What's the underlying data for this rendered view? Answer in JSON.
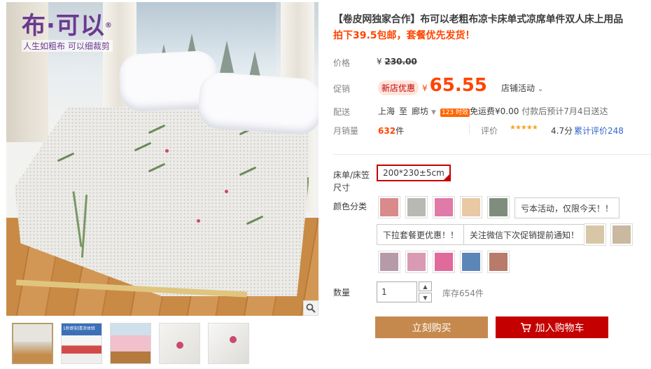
{
  "gallery": {
    "brand_mark": "布·可以",
    "brand_tm": "®",
    "brand_slogan": "人生如粗布  可以细裁剪",
    "thumbnail_badge": "1秒即刻清凉体验"
  },
  "product": {
    "title": "【卷皮网独家合作】布可以老粗布凉卡床单式凉席单件双人床上用品",
    "subtitle": "拍下39.5包邮，套餐优先发货！"
  },
  "price": {
    "label": "价格",
    "currency": "¥",
    "original": "230.00"
  },
  "promo": {
    "label": "促销",
    "tag": "新店优惠",
    "currency": "¥",
    "price": "65.55",
    "shop_activity": "店铺活动"
  },
  "delivery": {
    "label": "配送",
    "from": "上海",
    "to_word": "至",
    "to_city": "廊坊",
    "badge": "123 时效",
    "fee": "免运费¥0.00",
    "eta": "付款后预计7月4日送达"
  },
  "sales": {
    "label": "月销量",
    "count": "632",
    "unit": "件",
    "rating_label": "评价",
    "stars": "★★★★★",
    "rating": "4.7分",
    "reviews": "累计评价248"
  },
  "sku": {
    "size_label": "床单/床笠尺寸",
    "size_option": "200*230±5cm",
    "color_label": "颜色分类",
    "text_options": [
      "亏本活动，仅限今天！！",
      "下拉套餐更优惠！！",
      "关注微信下次促销提前通知！"
    ],
    "swatch_colors": [
      "#d98a8a",
      "#b9b8b4",
      "#e07aa8",
      "#e9c8a4",
      "#7f8d7c",
      "#d7c7a6",
      "#c9b9a0",
      "#b79aa8",
      "#d99ab4",
      "#e06a9a",
      "#5d86b8",
      "#b87a6a"
    ]
  },
  "quantity": {
    "label": "数量",
    "value": "1",
    "stock": "库存654件"
  },
  "actions": {
    "buy": "立刻购买",
    "cart": "加入购物车"
  },
  "colors": {
    "accent": "#f40",
    "cart_button": "#c40000",
    "buy_button": "#c6894d"
  }
}
